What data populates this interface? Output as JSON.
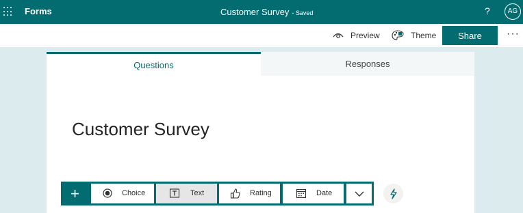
{
  "topbar": {
    "app_name": "Forms",
    "doc_title": "Customer Survey",
    "status": "- Saved",
    "help": "?",
    "avatar": "AG",
    "icons": {
      "launcher": "waffle-icon"
    }
  },
  "commands": {
    "preview": "Preview",
    "theme": "Theme",
    "share": "Share",
    "more": "···",
    "icons": {
      "preview": "eye-icon",
      "theme": "palette-icon"
    }
  },
  "tabs": [
    {
      "label": "Questions",
      "selected": true
    },
    {
      "label": "Responses",
      "selected": false
    }
  ],
  "form": {
    "title": "Customer Survey"
  },
  "add_toolbar": {
    "plus": "+",
    "buttons": [
      {
        "label": "Choice",
        "icon": "radio-icon"
      },
      {
        "label": "Text",
        "icon": "text-box-icon",
        "active": true
      },
      {
        "label": "Rating",
        "icon": "thumb-icon"
      },
      {
        "label": "Date",
        "icon": "calendar-icon"
      }
    ],
    "more_icon": "chevron-down-icon",
    "suggest_icon": "lightning-icon"
  },
  "colors": {
    "accent": "#036c70",
    "page_bg": "#dcebed",
    "tab_inactive_bg": "#f3f7f7"
  }
}
